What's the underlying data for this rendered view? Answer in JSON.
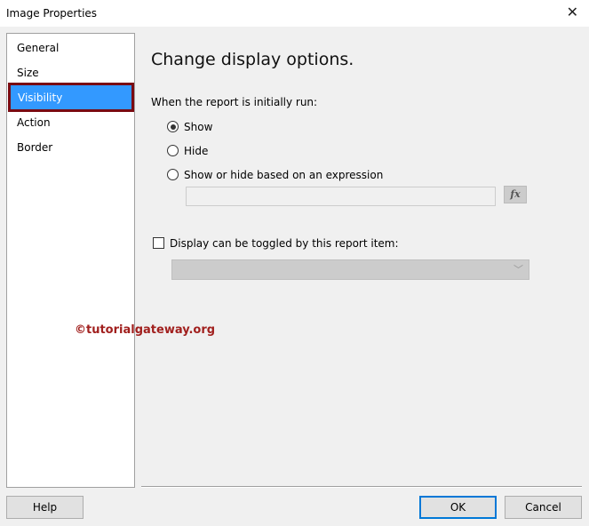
{
  "window": {
    "title": "Image Properties",
    "close_icon": "close-icon"
  },
  "nav": {
    "items": [
      {
        "label": "General"
      },
      {
        "label": "Size"
      },
      {
        "label": "Visibility",
        "selected": true
      },
      {
        "label": "Action"
      },
      {
        "label": "Border"
      }
    ]
  },
  "main": {
    "heading": "Change display options.",
    "initial_label": "When the report is initially run:",
    "options": [
      {
        "label": "Show",
        "checked": true
      },
      {
        "label": "Hide",
        "checked": false
      },
      {
        "label": "Show or hide based on an expression",
        "checked": false
      }
    ],
    "expression_value": "",
    "fx_label": "fx",
    "toggle_label": "Display can be toggled by this report item:",
    "toggle_checked": false,
    "toggle_value": ""
  },
  "watermark": "©tutorialgateway.org",
  "footer": {
    "help": "Help",
    "ok": "OK",
    "cancel": "Cancel"
  }
}
